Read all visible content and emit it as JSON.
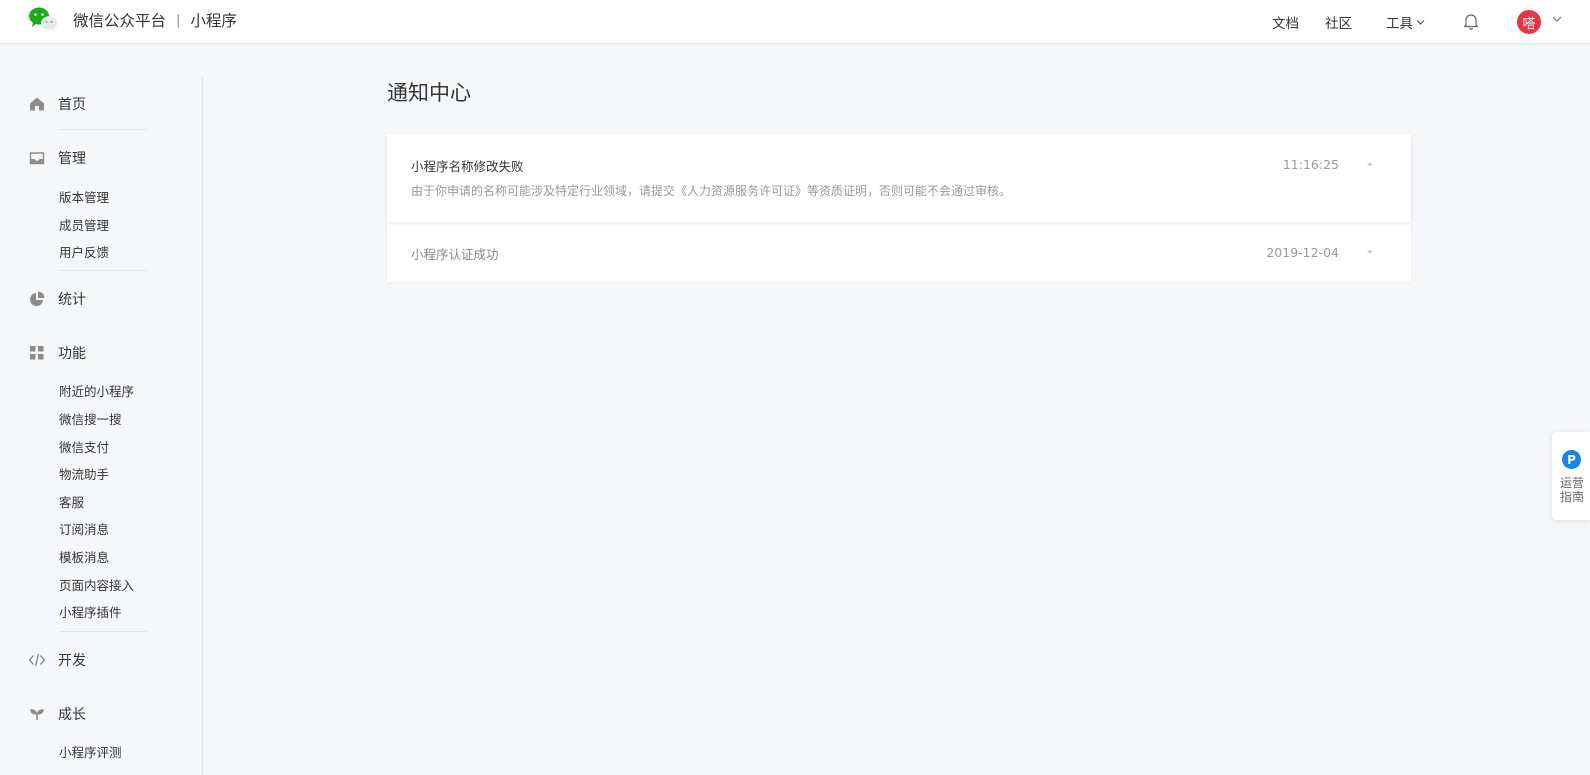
{
  "header": {
    "brand_name": "微信公众平台",
    "brand_separator": "|",
    "product_name": "小程序",
    "nav": {
      "docs": "文档",
      "community": "社区",
      "tools": "工具"
    },
    "avatar_text": "嗒",
    "icons": [
      "wechat-logo-icon",
      "chevron-down-icon",
      "bell-icon"
    ]
  },
  "sidebar": {
    "home": "首页",
    "manage": {
      "label": "管理",
      "items": [
        "版本管理",
        "成员管理",
        "用户反馈"
      ]
    },
    "stats": "统计",
    "features": {
      "label": "功能",
      "items": [
        "附近的小程序",
        "微信搜一搜",
        "微信支付",
        "物流助手",
        "客服",
        "订阅消息",
        "模板消息",
        "页面内容接入",
        "小程序插件"
      ]
    },
    "develop": "开发",
    "growth": {
      "label": "成长",
      "items": [
        "小程序评测"
      ]
    }
  },
  "main": {
    "title": "通知中心",
    "notices": [
      {
        "title": "小程序名称修改失败",
        "time": "11:16:25",
        "description": "由于你申请的名称可能涉及特定行业领域，请提交《人力资源服务许可证》等资质证明，否则可能不会通过审核。",
        "expanded": true
      },
      {
        "title": "小程序认证成功",
        "time": "2019-12-04",
        "expanded": false
      }
    ]
  },
  "float_guide": {
    "badge": "P",
    "label": "运营指南"
  },
  "colors": {
    "avatar": "#e9343d",
    "guide_badge": "#1485ee",
    "wechat_green": "#1aad19"
  }
}
